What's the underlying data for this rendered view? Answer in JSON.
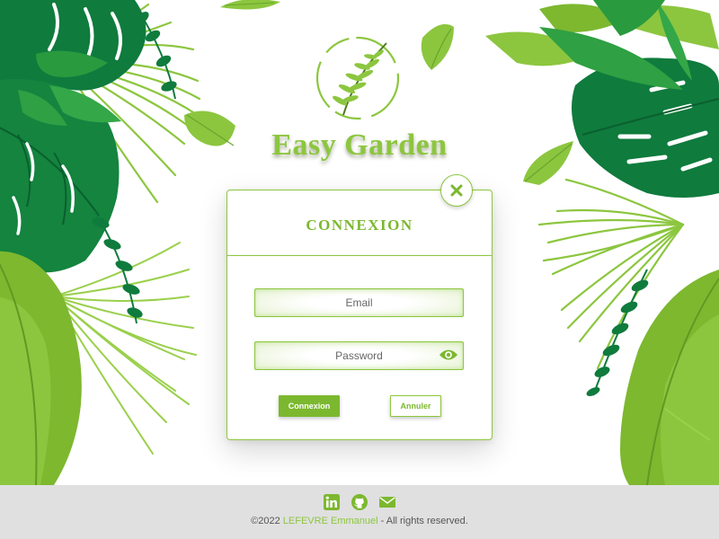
{
  "brand": {
    "title": "Easy Garden"
  },
  "login": {
    "title": "CONNEXION",
    "email_placeholder": "Email",
    "password_placeholder": "Password",
    "submit_label": "Connexion",
    "cancel_label": "Annuler"
  },
  "icons": {
    "close": "close-icon",
    "eye": "eye-icon",
    "linkedin": "linkedin-icon",
    "github": "github-icon",
    "mail": "mail-icon"
  },
  "footer": {
    "copyright_prefix": "©2022 ",
    "author": "LEFEVRE Emmanuel",
    "copyright_suffix": " - All rights reserved."
  },
  "colors": {
    "accent": "#8cc63f",
    "button": "#7cb82f",
    "dark_leaf": "#0f7b3d",
    "footer_bg": "#e0e0e0"
  }
}
